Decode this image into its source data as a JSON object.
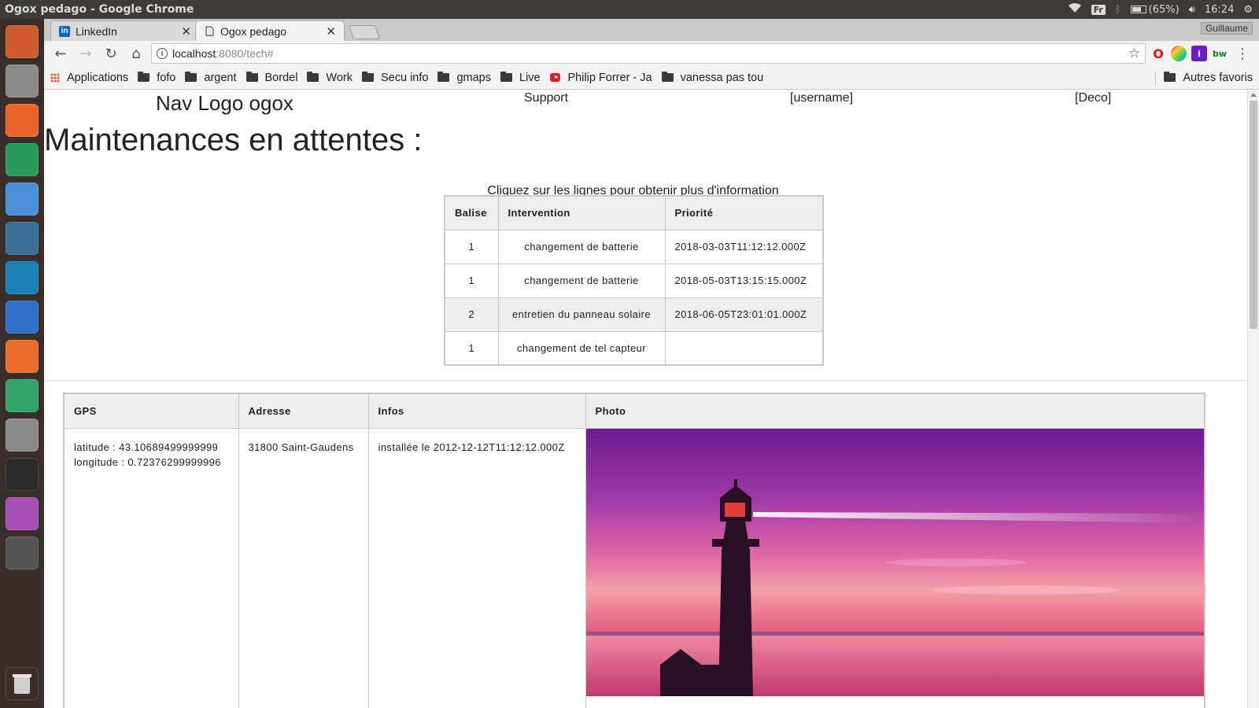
{
  "os": {
    "window_title": "Ogox pedago - Google Chrome",
    "keyboard_layout": "Fr",
    "battery": "(65%)",
    "battery_level": 0.65,
    "clock": "16:24",
    "launcher_icons": [
      "ubuntu-logo-icon",
      "files-icon",
      "firefox-icon",
      "atom-icon",
      "chrome-icon",
      "mysql-workbench-icon",
      "webstorm-icon",
      "vscode-icon",
      "software-center-icon",
      "telegram-icon",
      "settings-icon",
      "terminal-icon",
      "screenshot-icon",
      "workspace-switcher-icon",
      "trash-icon"
    ],
    "launcher_colors": [
      "#cf5a2e",
      "#8a8a8a",
      "#e9662b",
      "#2c9a5a",
      "#4a8fd8",
      "#3a6f9a",
      "#1a7fb5",
      "#2f6fc8",
      "#e96e2b",
      "#33a36a",
      "#8a8a8a",
      "#2b2b2b",
      "#a84fb5",
      "#555555"
    ]
  },
  "browser": {
    "tabs": [
      {
        "label": "LinkedIn",
        "active": false,
        "favicon": "linkedin-icon"
      },
      {
        "label": "Ogox pedago",
        "active": true,
        "favicon": "page-icon"
      }
    ],
    "profile_name": "Guillaume",
    "url_host": "localhost",
    "url_rest": ":8080/tech#",
    "bookmarks": [
      {
        "label": "Applications",
        "icon": "apps-grid-icon"
      },
      {
        "label": "fofo",
        "icon": "folder-icon"
      },
      {
        "label": "argent",
        "icon": "folder-icon"
      },
      {
        "label": "Bordel",
        "icon": "folder-icon"
      },
      {
        "label": "Work",
        "icon": "folder-icon"
      },
      {
        "label": "Secu info",
        "icon": "folder-icon"
      },
      {
        "label": "gmaps",
        "icon": "folder-icon"
      },
      {
        "label": "Live",
        "icon": "folder-icon"
      },
      {
        "label": "Philip Forrer - Ja",
        "icon": "youtube-icon"
      },
      {
        "label": "vanessa pas tou",
        "icon": "folder-icon"
      }
    ],
    "other_bookmarks": "Autres favoris"
  },
  "page": {
    "nav": {
      "logo": "Nav Logo ogox",
      "support": "Support",
      "username": "[username]",
      "deco": "[Deco]"
    },
    "title": "Maintenances en attentes :",
    "subtitle": "Cliquez sur les lignes pour obtenir plus d'information",
    "maintenance_table": {
      "headers": [
        "Balise",
        "Intervention",
        "Priorité"
      ],
      "rows": [
        {
          "balise": "1",
          "intervention": "changement de batterie",
          "priorite": "2018-03-03T11:12:12.000Z"
        },
        {
          "balise": "1",
          "intervention": "changement de batterie",
          "priorite": "2018-05-03T13:15:15.000Z"
        },
        {
          "balise": "2",
          "intervention": "entretien du panneau solaire",
          "priorite": "2018-06-05T23:01:01.000Z"
        },
        {
          "balise": "1",
          "intervention": "changement de tel capteur",
          "priorite": ""
        }
      ]
    },
    "detail_table": {
      "headers": [
        "GPS",
        "Adresse",
        "Infos",
        "Photo"
      ],
      "gps_latitude": "latitude : 43.10689499999999",
      "gps_longitude": "longitude : 0.72376299999996",
      "adresse": "31800 Saint-Gaudens",
      "infos": "installée le 2012-12-12T11:12:12.000Z",
      "photo": "lighthouse-sunset-photo"
    }
  }
}
